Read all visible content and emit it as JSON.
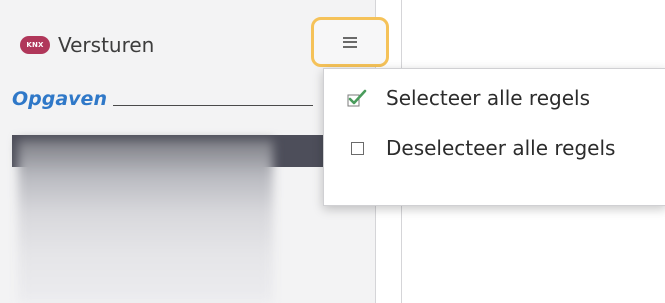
{
  "header": {
    "logo_text": "KNX",
    "title": "Versturen",
    "menu_icon": "hamburger-menu-icon"
  },
  "section": {
    "label": "Opgaven"
  },
  "dropdown": {
    "items": [
      {
        "label": "Selecteer alle regels",
        "icon": "checked-checkbox-icon"
      },
      {
        "label": "Deselecteer alle regels",
        "icon": "empty-checkbox-icon"
      }
    ]
  },
  "colors": {
    "accent": "#2f78c8",
    "focus_ring": "#f5c259",
    "logo": "#b0375a",
    "check": "#4a9c5c"
  }
}
